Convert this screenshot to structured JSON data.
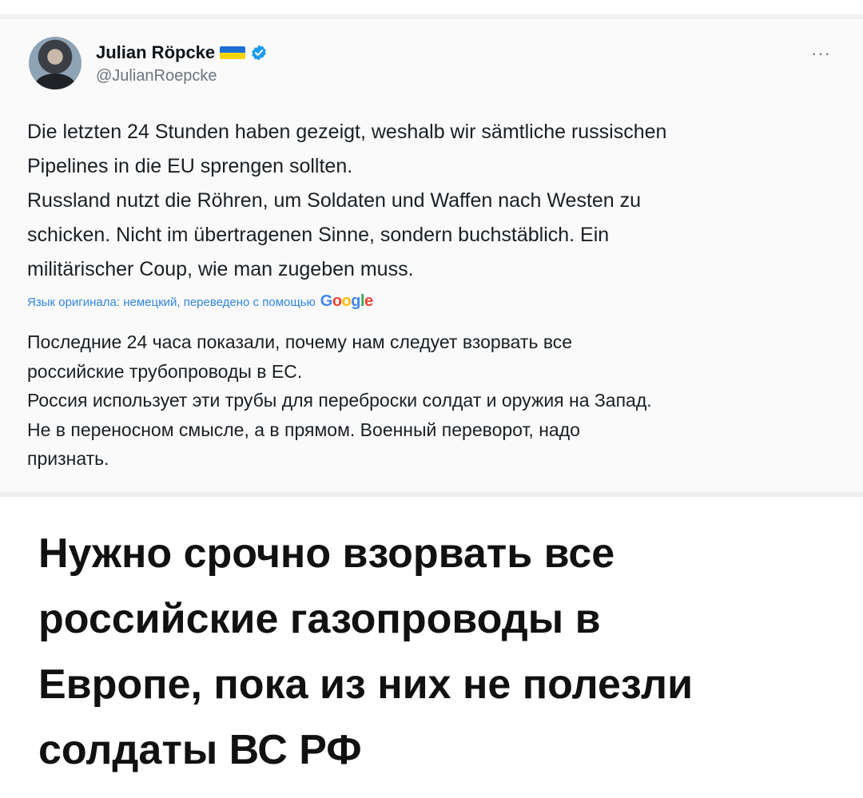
{
  "tweet": {
    "author_name": "Julian Röpcke",
    "handle": "@JulianRoepcke",
    "more_label": "···",
    "text_lines": [
      "Die letzten 24 Stunden haben gezeigt, weshalb wir sämtliche russischen",
      "Pipelines in die EU sprengen sollten.",
      "Russland nutzt die Röhren, um Soldaten und Waffen nach Westen zu",
      "schicken. Nicht im übertragenen Sinne, sondern buchstäblich. Ein",
      "militärischer Coup, wie man zugeben muss."
    ],
    "translation_note": "Язык оригинала: немецкий, переведено с помощью",
    "google_logo": "Google",
    "translation_lines": [
      "Последние 24 часа показали, почему нам следует взорвать все",
      "российские трубопроводы в ЕС.",
      "Россия использует эти трубы для переброски солдат и оружия на Запад.",
      "Не в переносном смысле, а в прямом. Военный переворот, надо",
      "признать."
    ]
  },
  "caption_lines": [
    "Нужно срочно взорвать все",
    "российские газопроводы в",
    "Европе, пока из них не полезли",
    "солдаты ВС РФ"
  ],
  "colors": {
    "verified": "#1d9bf0",
    "flag_blue": "#1d6fd6",
    "flag_yellow": "#f6d40a",
    "translate_link": "#2f85e6"
  }
}
